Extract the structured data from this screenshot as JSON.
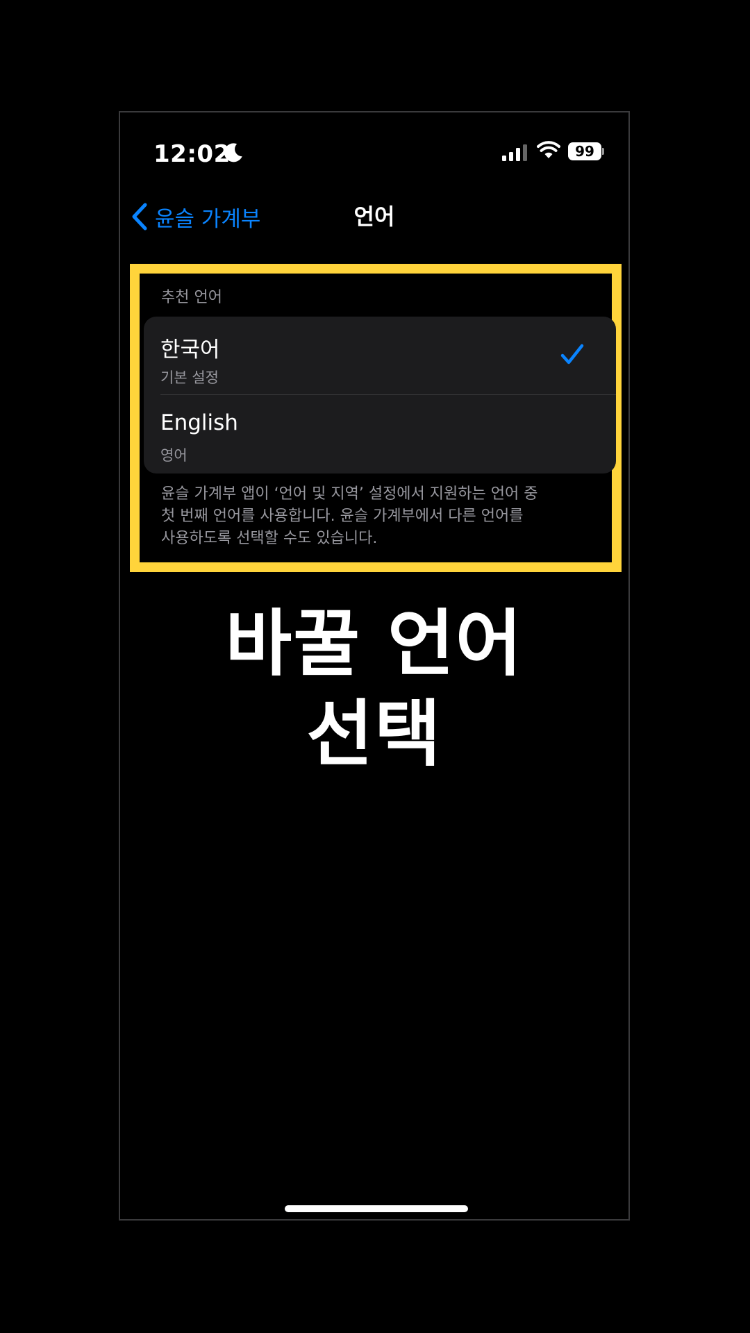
{
  "status_bar": {
    "time": "12:02",
    "battery": "99",
    "icons": [
      "moon-icon",
      "cellular-signal-icon",
      "wifi-icon",
      "battery-icon"
    ]
  },
  "nav": {
    "back_label": "윤슬 가계부",
    "title": "언어"
  },
  "language_section": {
    "header": "추천 언어",
    "options": [
      {
        "title": "한국어",
        "subtitle": "기본 설정",
        "selected": true
      },
      {
        "title": "English",
        "subtitle": "영어",
        "selected": false
      }
    ],
    "footer_lines": [
      "윤슬 가계부 앱이 ‘언어 및 지역’ 설정에서 지원하는 언어 중",
      "첫 번째 언어를 사용합니다. 윤슬 가계부에서 다른 언어를",
      "사용하도록 선택할 수도 있습니다."
    ]
  },
  "caption": {
    "line1": "바꿀 언어",
    "line2": "선택"
  },
  "colors": {
    "accent": "#0a84ff",
    "highlight": "#ffd43b",
    "background": "#000000",
    "group_background": "#1c1c1e"
  }
}
